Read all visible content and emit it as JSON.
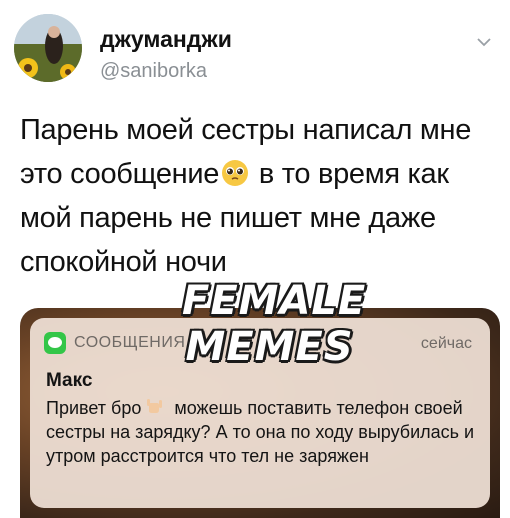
{
  "tweet": {
    "display_name": "джуманджи",
    "handle": "@saniborka",
    "text_part1": "Парень моей сестры написал мне это сообщение",
    "text_part2": " в то время как мой парень не пишет мне даже спокойной ночи",
    "emoji": "pleading-face-emoji",
    "menu_icon": "chevron-down-icon"
  },
  "watermark": {
    "line1": "FEMALE",
    "line2": "MEMES"
  },
  "notification": {
    "app_name": "СООБЩЕНИЯ",
    "time": "сейчас",
    "sender": "Макс",
    "body_part1": "Привет бро",
    "body_part2": " можешь поставить телефон своей сестры на зарядку? А то она по ходу вырубилась и утром  расстроится что тел не заряжен",
    "app_icon": "messages-icon",
    "hand_emoji": "call-me-hand-emoji"
  },
  "colors": {
    "notification_bg": "#eedfd4",
    "messages_green": "#33c648",
    "handle_gray": "#8a8f94"
  }
}
